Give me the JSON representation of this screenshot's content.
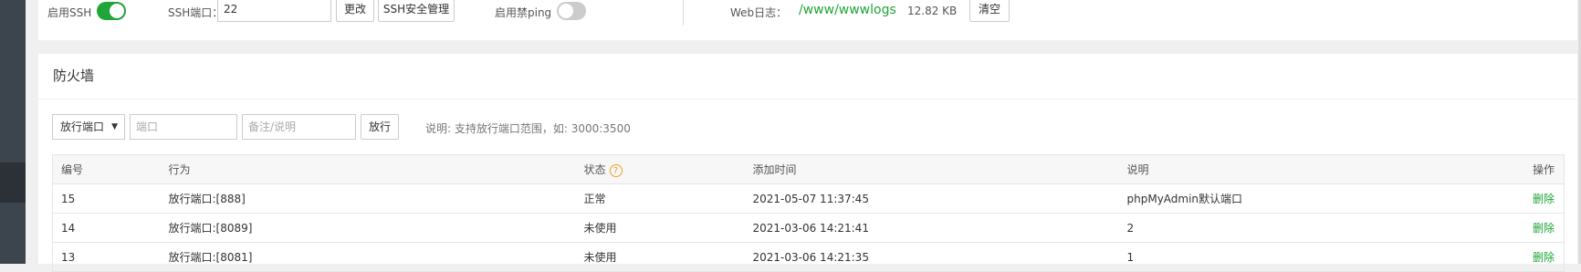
{
  "ssh": {
    "enable_label": "启用SSH",
    "enabled": true,
    "port_label": "SSH端口：",
    "port_value": "22",
    "change_button": "更改",
    "manage_button": "SSH安全管理",
    "ping_label": "启用禁ping",
    "ping_enabled": false,
    "web_log_label": "Web日志：",
    "web_log_path": "/www/wwwlogs",
    "web_log_size": "12.82 KB",
    "clear_button": "清空"
  },
  "firewall": {
    "title": "防火墙",
    "select_value": "放行端口",
    "port_placeholder": "端口",
    "note_placeholder": "备注/说明",
    "allow_button": "放行",
    "hint": "说明: 支持放行端口范围，如: 3000:3500",
    "columns": {
      "id": "编号",
      "action": "行为",
      "status": "状态",
      "time": "添加时间",
      "note": "说明",
      "op": "操作"
    },
    "rows": [
      {
        "id": "15",
        "action": "放行端口:[888]",
        "status": "正常",
        "time": "2021-05-07 11:37:45",
        "note": "phpMyAdmin默认端口",
        "op": "删除"
      },
      {
        "id": "14",
        "action": "放行端口:[8089]",
        "status": "未使用",
        "time": "2021-03-06 14:21:41",
        "note": "2",
        "op": "删除"
      },
      {
        "id": "13",
        "action": "放行端口:[8081]",
        "status": "未使用",
        "time": "2021-03-06 14:21:35",
        "note": "1",
        "op": "删除"
      }
    ]
  },
  "colors": {
    "accent": "#20a53a",
    "help": "#f0a020",
    "sidebar": "#3c444d"
  },
  "icons": {
    "dropdown": "caret-down-icon",
    "status_help": "question-circle-icon"
  }
}
